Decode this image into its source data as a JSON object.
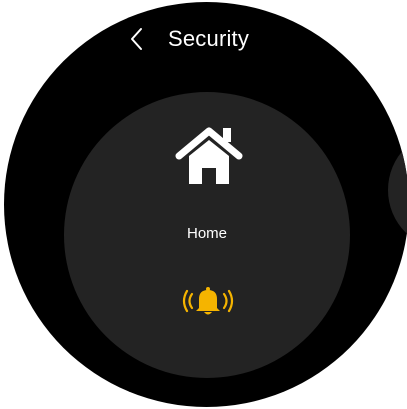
{
  "header": {
    "title": "Security",
    "back_icon": "chevron-left-icon"
  },
  "device_card": {
    "label": "Home",
    "icon": "home-icon",
    "status_icon": "alarm-bell-icon",
    "status_color": "#f5b400"
  },
  "colors": {
    "screen_background": "#000000",
    "card_background": "#232323",
    "text": "#ffffff",
    "accent": "#f5b400"
  }
}
